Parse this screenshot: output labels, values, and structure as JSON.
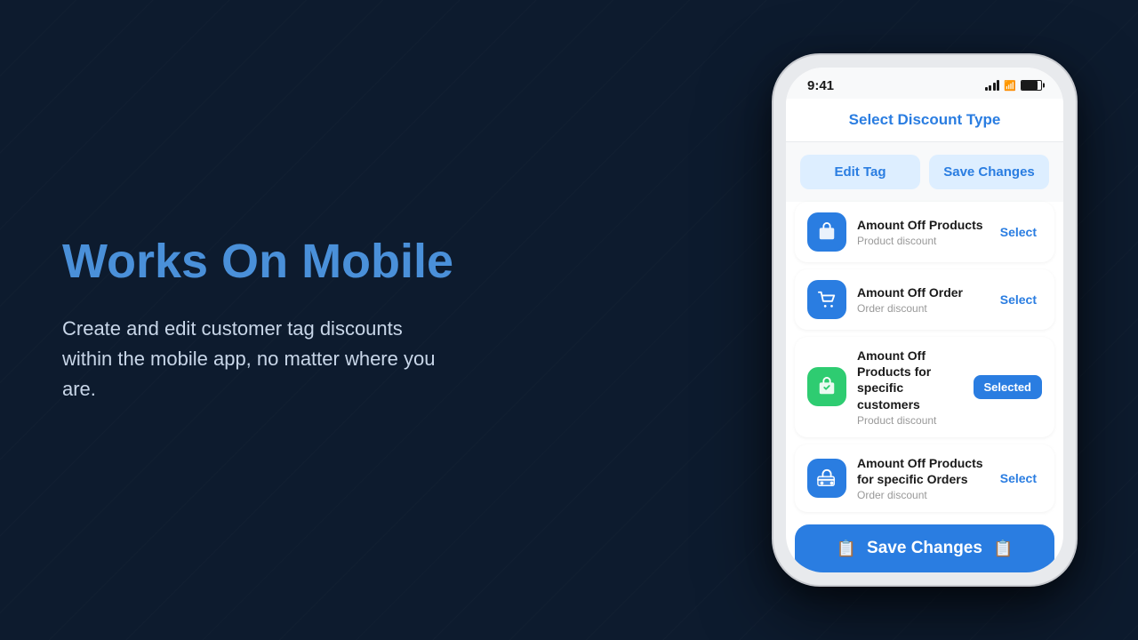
{
  "page": {
    "background": "#0d1b2e"
  },
  "left": {
    "heading_plain": "Works On ",
    "heading_accent": "Mobile",
    "description": "Create and edit customer tag discounts within the mobile app, no matter where you are."
  },
  "phone": {
    "status_bar": {
      "time": "9:41",
      "signal_label": "signal",
      "wifi_label": "wifi",
      "battery_label": "battery"
    },
    "header": {
      "title": "Select Discount Type"
    },
    "action_buttons": {
      "edit_tag": "Edit Tag",
      "save_changes": "Save Changes"
    },
    "discount_items": [
      {
        "id": "amount-off-products",
        "name": "Amount Off Products",
        "sub": "Product discount",
        "icon_color": "blue",
        "icon_emoji": "📦",
        "button_label": "Select",
        "selected": false
      },
      {
        "id": "amount-off-order",
        "name": "Amount Off Order",
        "sub": "Order discount",
        "icon_color": "blue",
        "icon_emoji": "🛒",
        "button_label": "Select",
        "selected": false
      },
      {
        "id": "amount-off-products-customers",
        "name": "Amount Off Products for specific customers",
        "sub": "Product discount",
        "icon_color": "green",
        "icon_emoji": "📦",
        "button_label": "Selected",
        "selected": true
      },
      {
        "id": "amount-off-products-orders",
        "name": "Amount Off Products for specific Orders",
        "sub": "Order discount",
        "icon_color": "blue",
        "icon_emoji": "🚚",
        "button_label": "Select",
        "selected": false
      }
    ],
    "bottom_button": {
      "label": "Save Changes"
    }
  }
}
